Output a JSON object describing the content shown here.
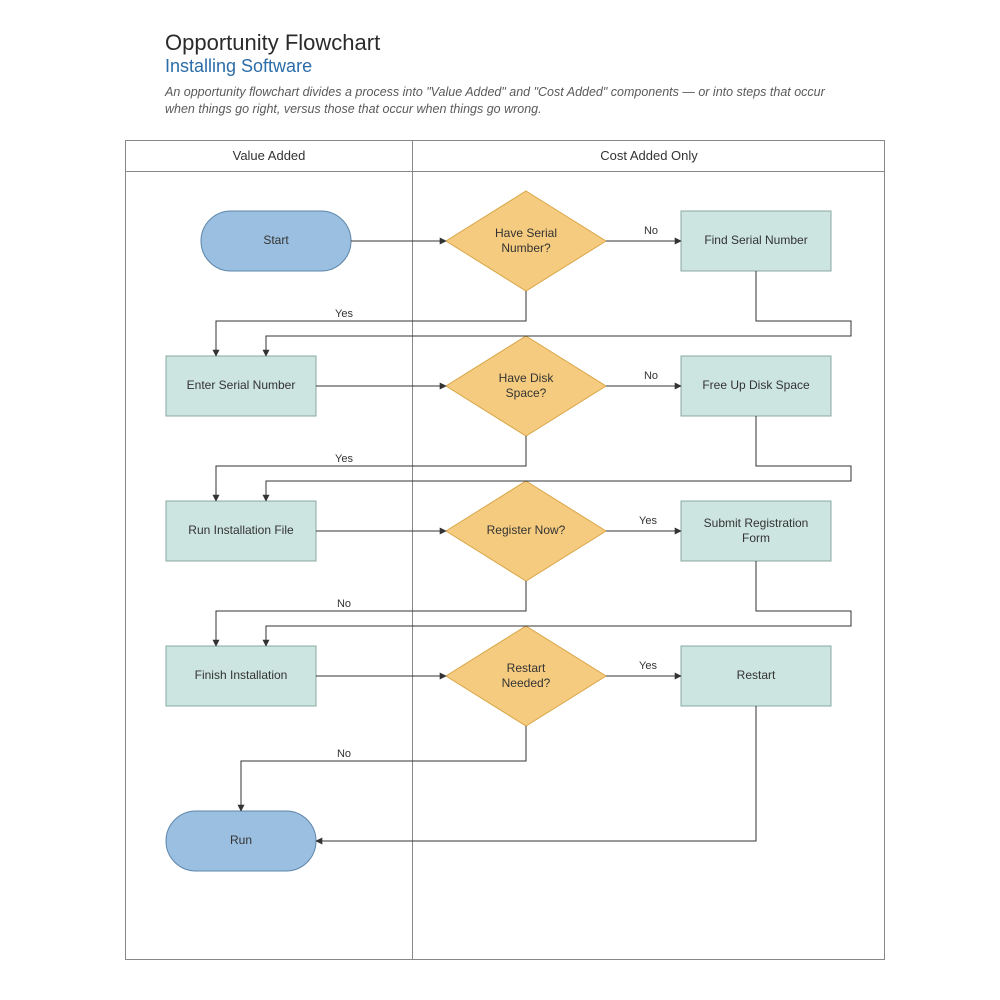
{
  "title": "Opportunity Flowchart",
  "subtitle": "Installing Software",
  "description": "An opportunity flowchart divides a process into \"Value Added\" and \"Cost Added\" components — or into steps that occur when things go right, versus those that occur when things go wrong.",
  "lanes": {
    "left": "Value Added",
    "right": "Cost Added Only"
  },
  "labels": {
    "yes": "Yes",
    "no": "No"
  },
  "nodes": {
    "start": {
      "text": "Start"
    },
    "d_serial": {
      "text1": "Have Serial",
      "text2": "Number?"
    },
    "find_serial": {
      "text": "Find Serial Number"
    },
    "enter_serial": {
      "text": "Enter Serial Number"
    },
    "d_disk": {
      "text1": "Have Disk",
      "text2": "Space?"
    },
    "free_disk": {
      "text": "Free Up Disk Space"
    },
    "run_install": {
      "text": "Run Installation File"
    },
    "d_register": {
      "text": "Register Now?"
    },
    "submit_reg": {
      "text1": "Submit Registration",
      "text2": "Form"
    },
    "finish": {
      "text": "Finish Installation"
    },
    "d_restart": {
      "text1": "Restart",
      "text2": "Needed?"
    },
    "restart": {
      "text": "Restart"
    },
    "run": {
      "text": "Run"
    }
  }
}
